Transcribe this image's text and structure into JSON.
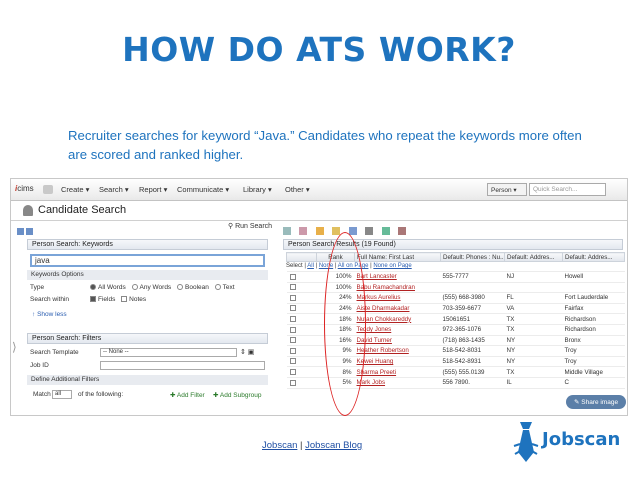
{
  "slide": {
    "title": "HOW DO ATS WORK?",
    "subtitle": "Recruiter searches for keyword “Java.” Candidates who repeat the keywords more often are scored and ranked higher."
  },
  "app": {
    "logo_prefix": "i",
    "logo_text": "cims",
    "menu": [
      "Create ▾",
      "Search ▾",
      "Report ▾",
      "Communicate ▾",
      "Library ▾",
      "Other ▾"
    ],
    "person_select": "Person ▾",
    "quick_search_placeholder": "Quick Search...",
    "page_title": "Candidate Search",
    "run_search": "Run Search"
  },
  "keywords_panel": {
    "title": "Person Search: Keywords",
    "keyword_value": "java",
    "options_title": "Keywords Options",
    "type_label": "Type",
    "type_options": [
      "All Words",
      "Any Words",
      "Boolean",
      "Text"
    ],
    "type_selected": "All Words",
    "search_within_label": "Search within",
    "within_options": [
      "Fields",
      "Notes"
    ],
    "within_checked": [
      "Fields"
    ],
    "show_less": "Show less"
  },
  "filters_panel": {
    "title": "Person Search: Filters",
    "template_label": "Search Template",
    "template_value": "-- None --",
    "job_id_label": "Job ID",
    "define_title": "Define Additional Filters",
    "match_label": "Match",
    "match_value": "all",
    "of_following": "of the following:",
    "add_filter": "Add Filter",
    "add_subgroup": "Add Subgroup"
  },
  "results": {
    "title": "Person Search Results (19 Found)",
    "select_links": [
      "Select",
      "All",
      "None",
      "All on Page",
      "None on Page"
    ],
    "columns": [
      "",
      "Rank",
      "Full Name: First Last",
      "Default: Phones : Nu...",
      "Default: Addres...",
      "Default: Addres..."
    ],
    "rows": [
      {
        "rank": "100%",
        "name": "Bart Lancaster",
        "phone": "555-7777",
        "state": "NJ",
        "city": "Howell"
      },
      {
        "rank": "100%",
        "name": "Babu Ramachandran",
        "phone": "",
        "state": "",
        "city": ""
      },
      {
        "rank": "24%",
        "name": "Markus Aurelius",
        "phone": "(555) 668-3980",
        "state": "FL",
        "city": "Fort Lauderdale"
      },
      {
        "rank": "24%",
        "name": "Aiste Dharmakadar",
        "phone": "703-359-6677",
        "state": "VA",
        "city": "Fairfax"
      },
      {
        "rank": "18%",
        "name": "Nutan Chokkareddy",
        "phone": "15061651",
        "state": "TX",
        "city": "Richardson"
      },
      {
        "rank": "18%",
        "name": "Teddy Jones",
        "phone": "972-365-1076",
        "state": "TX",
        "city": "Richardson"
      },
      {
        "rank": "16%",
        "name": "David Turner",
        "phone": "(718) 863-1435",
        "state": "NY",
        "city": "Bronx"
      },
      {
        "rank": "9%",
        "name": "Heather Robertson",
        "phone": "518-542-8031",
        "state": "NY",
        "city": "Troy"
      },
      {
        "rank": "9%",
        "name": "Kewei Huang",
        "phone": "518-542-8931",
        "state": "NY",
        "city": "Troy"
      },
      {
        "rank": "8%",
        "name": "Sharma Preeti",
        "phone": "(555) 555.0139",
        "state": "TX",
        "city": "Middle Village"
      },
      {
        "rank": "5%",
        "name": "Mark Jobs",
        "phone": "556 7890.",
        "state": "IL",
        "city": "C"
      }
    ],
    "share_image": "Share image"
  },
  "footer": {
    "link1": "Jobscan",
    "separator": "|",
    "link2": "Jobscan Blog",
    "brand": "Jobscan"
  },
  "colors": {
    "title_blue": "#1e73be",
    "name_red": "#b22222",
    "oval_red": "#dd2222"
  }
}
